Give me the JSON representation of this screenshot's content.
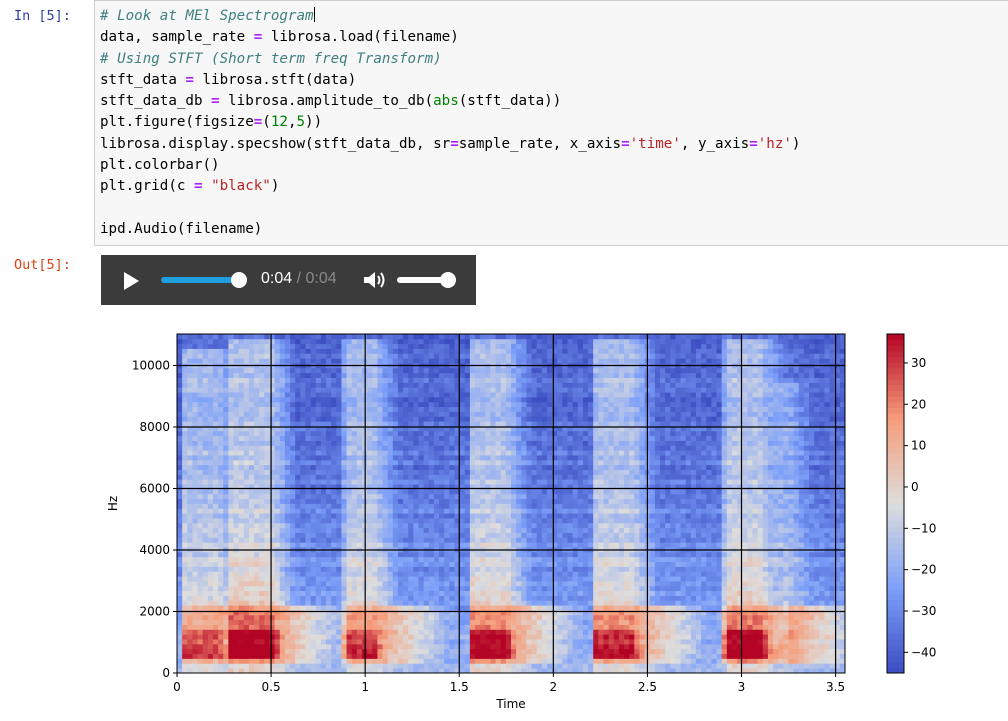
{
  "cell": {
    "in_prompt": "In [5]:",
    "out_prompt": "Out[5]:",
    "code_lines": [
      [
        {
          "t": "# Look at MEl Spectrogram",
          "c": "comment"
        }
      ],
      [
        {
          "t": "data, sample_rate "
        },
        {
          "t": "=",
          "c": "op"
        },
        {
          "t": " librosa.load(filename)"
        }
      ],
      [
        {
          "t": "# Using STFT (Short term freq Transform)",
          "c": "comment"
        }
      ],
      [
        {
          "t": "stft_data "
        },
        {
          "t": "=",
          "c": "op"
        },
        {
          "t": " librosa.stft(data)"
        }
      ],
      [
        {
          "t": "stft_data_db "
        },
        {
          "t": "=",
          "c": "op"
        },
        {
          "t": " librosa.amplitude_to_db("
        },
        {
          "t": "abs",
          "c": "builtin"
        },
        {
          "t": "(stft_data))"
        }
      ],
      [
        {
          "t": "plt.figure(figsize"
        },
        {
          "t": "=",
          "c": "op"
        },
        {
          "t": "("
        },
        {
          "t": "12",
          "c": "num"
        },
        {
          "t": ","
        },
        {
          "t": "5",
          "c": "num"
        },
        {
          "t": "))"
        }
      ],
      [
        {
          "t": "librosa.display.specshow(stft_data_db, sr"
        },
        {
          "t": "=",
          "c": "op"
        },
        {
          "t": "sample_rate, x_axis"
        },
        {
          "t": "=",
          "c": "op"
        },
        {
          "t": "'time'",
          "c": "str"
        },
        {
          "t": ", y_axis"
        },
        {
          "t": "=",
          "c": "op"
        },
        {
          "t": "'hz'",
          "c": "str"
        },
        {
          "t": ")"
        }
      ],
      [
        {
          "t": "plt.colorbar()"
        }
      ],
      [
        {
          "t": "plt.grid(c "
        },
        {
          "t": "=",
          "c": "op"
        },
        {
          "t": " "
        },
        {
          "t": "\"black\"",
          "c": "str"
        },
        {
          "t": ")"
        }
      ],
      [
        {
          "t": ""
        }
      ],
      [
        {
          "t": "ipd.Audio(filename)"
        }
      ]
    ]
  },
  "audio": {
    "current_time": "0:04",
    "separator": " / ",
    "duration": "0:04",
    "progress": 1.0,
    "volume": 1.0,
    "play_icon": "play-icon",
    "volume_icon": "volume-icon"
  },
  "chart_data": {
    "type": "heatmap",
    "xlabel": "Time",
    "ylabel": "Hz",
    "xlim": [
      0,
      3.55
    ],
    "ylim": [
      0,
      11025
    ],
    "x_ticks": [
      0,
      0.5,
      1,
      1.5,
      2,
      2.5,
      3,
      3.5
    ],
    "x_tick_labels": [
      "0",
      "0.5",
      "1",
      "1.5",
      "2",
      "2.5",
      "3",
      "3.5"
    ],
    "y_ticks": [
      0,
      2000,
      4000,
      6000,
      8000,
      10000
    ],
    "y_tick_labels": [
      "0",
      "2000",
      "4000",
      "6000",
      "8000",
      "10000"
    ],
    "grid": true,
    "grid_color": "#000000",
    "colormap": "coolwarm",
    "colorbar": {
      "vmin": -45,
      "vmax": 37,
      "ticks": [
        30,
        20,
        10,
        0,
        -10,
        -20,
        -30,
        -40
      ],
      "tick_labels": [
        "30",
        "20",
        "10",
        "0",
        "−10",
        "−20",
        "−30",
        "−40"
      ]
    },
    "events": [
      {
        "start": 0.02,
        "end": 0.22,
        "top": 10600,
        "peak": 1.0
      },
      {
        "start": 0.26,
        "end": 0.5,
        "top": 10900,
        "peak": 1.25
      },
      {
        "start": 0.88,
        "end": 1.05,
        "top": 10900,
        "peak": 1.05
      },
      {
        "start": 1.55,
        "end": 1.75,
        "top": 10800,
        "peak": 1.15
      },
      {
        "start": 2.2,
        "end": 2.42,
        "top": 10900,
        "peak": 1.1
      },
      {
        "start": 2.9,
        "end": 3.1,
        "top": 10900,
        "peak": 1.2
      },
      {
        "start": 3.1,
        "end": 3.25,
        "top": 9500,
        "peak": 0.7
      }
    ]
  }
}
